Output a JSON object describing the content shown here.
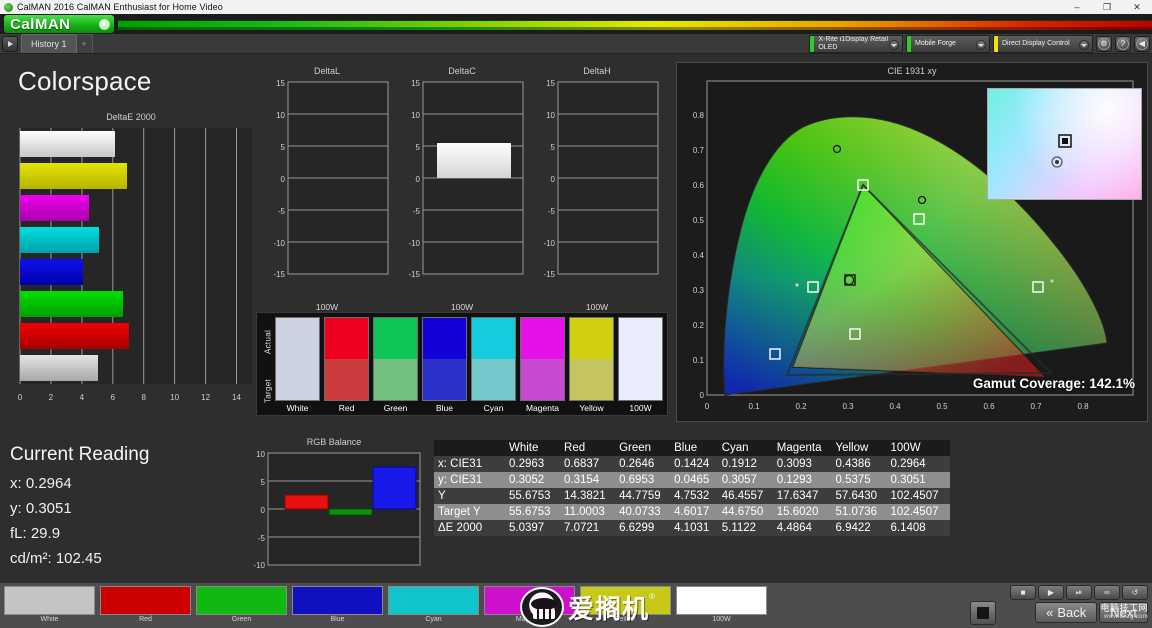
{
  "window": {
    "title": "CalMAN 2016 CalMAN Enthusiast for Home Video",
    "app_icon": "calman-app-icon",
    "minimize": "–",
    "maximize": "❐",
    "close": "✕"
  },
  "brand": {
    "name": "CalMAN",
    "dot_icon": "brand-dot-icon"
  },
  "toolbar": {
    "play_icon": "play-icon",
    "history_tab": "History 1",
    "history_add": "+",
    "meter": {
      "label": "X-Rite i1Display Retail\nOLED",
      "status_color": "#2ecc2e"
    },
    "source": {
      "label": "Mobile Forge",
      "status_color": "#2ecc2e"
    },
    "control": {
      "label": "Direct Display Control",
      "status_color": "#e8e800"
    },
    "buttons": [
      {
        "name": "settings-button",
        "glyph": "⚙"
      },
      {
        "name": "help-button",
        "glyph": "?"
      },
      {
        "name": "info-button",
        "glyph": "◀"
      }
    ]
  },
  "page_title": "Colorspace",
  "chart_data": [
    {
      "type": "bar",
      "orientation": "horizontal",
      "title": "DeltaE 2000",
      "categories": [
        "100W",
        "Yellow",
        "Magenta",
        "Cyan",
        "Blue",
        "Green",
        "Red",
        "White"
      ],
      "values": [
        6.1408,
        6.9422,
        4.4864,
        5.1122,
        4.1031,
        6.6299,
        7.0721,
        5.0397
      ],
      "colors": [
        "#ffffff",
        "#d4d400",
        "#d400d4",
        "#00c8c8",
        "#0000d8",
        "#00c000",
        "#d00000",
        "#c8c8c8"
      ],
      "xlabel": "",
      "ylabel": "",
      "xlim": [
        0,
        15
      ],
      "xticks": [
        0,
        2,
        4,
        6,
        8,
        10,
        12,
        14
      ],
      "grid": true
    },
    {
      "type": "bar",
      "title": "DeltaL",
      "categories": [
        "100W"
      ],
      "values": [
        0
      ],
      "ylim": [
        -15,
        15
      ],
      "yticks": [
        15,
        10,
        5,
        0,
        -5,
        -10,
        -15
      ],
      "xlabel": "100W",
      "grid": true
    },
    {
      "type": "bar",
      "title": "DeltaC",
      "categories": [
        "100W"
      ],
      "values": [
        5.5
      ],
      "ylim": [
        -15,
        15
      ],
      "yticks": [
        15,
        10,
        5,
        0,
        -5,
        -10,
        -15
      ],
      "xlabel": "100W",
      "grid": true
    },
    {
      "type": "bar",
      "title": "DeltaH",
      "categories": [
        "100W"
      ],
      "values": [
        0
      ],
      "ylim": [
        -15,
        15
      ],
      "yticks": [
        15,
        10,
        5,
        0,
        -5,
        -10,
        -15
      ],
      "xlabel": "100W",
      "grid": true
    },
    {
      "type": "bar",
      "title": "RGB Balance",
      "categories": [
        "Red",
        "Green",
        "Blue"
      ],
      "values": [
        2.5,
        -1.0,
        7.5
      ],
      "colors": [
        "#e81010",
        "#109010",
        "#1818e8"
      ],
      "ylim": [
        -10,
        10
      ],
      "yticks": [
        10,
        5,
        0,
        -5,
        -10
      ],
      "xlabel": "100W",
      "grid": true
    },
    {
      "type": "scatter",
      "title": "CIE 1931 xy",
      "xlabel": "x",
      "ylabel": "y",
      "xlim": [
        0,
        0.85
      ],
      "ylim": [
        0,
        0.9
      ],
      "xticks": [
        0,
        0.1,
        0.2,
        0.3,
        0.4,
        0.5,
        0.6,
        0.7,
        0.8
      ],
      "yticks": [
        0,
        0.1,
        0.2,
        0.3,
        0.4,
        0.5,
        0.6,
        0.7,
        0.8
      ],
      "annotation": "Gamut Coverage:  142.1%",
      "series": [
        {
          "name": "White measured",
          "x": 0.2963,
          "y": 0.3052,
          "marker": "circle"
        },
        {
          "name": "Red measured",
          "x": 0.6837,
          "y": 0.3154,
          "marker": "square"
        },
        {
          "name": "Green measured",
          "x": 0.2646,
          "y": 0.6953,
          "marker": "circle"
        },
        {
          "name": "Blue measured",
          "x": 0.1424,
          "y": 0.0465,
          "marker": "square"
        },
        {
          "name": "Cyan measured",
          "x": 0.1912,
          "y": 0.3057,
          "marker": "square"
        },
        {
          "name": "Magenta measured",
          "x": 0.3093,
          "y": 0.1293,
          "marker": "square"
        },
        {
          "name": "Yellow measured",
          "x": 0.4386,
          "y": 0.5375,
          "marker": "circle"
        },
        {
          "name": "100W measured",
          "x": 0.2964,
          "y": 0.3051,
          "marker": "square"
        }
      ]
    }
  ],
  "deltaE_chart": {
    "title": "DeltaE 2000",
    "xticks": [
      "0",
      "2",
      "4",
      "6",
      "8",
      "10",
      "12",
      "14"
    ]
  },
  "small_charts": [
    {
      "title": "DeltaL",
      "xlabel": "100W",
      "value": 0,
      "yticks": [
        "15",
        "10",
        "5",
        "0",
        "-5",
        "-10",
        "-15"
      ]
    },
    {
      "title": "DeltaC",
      "xlabel": "100W",
      "value": 5.5,
      "yticks": [
        "15",
        "10",
        "5",
        "0",
        "-5",
        "-10",
        "-15"
      ]
    },
    {
      "title": "DeltaH",
      "xlabel": "100W",
      "value": 0,
      "yticks": [
        "15",
        "10",
        "5",
        "0",
        "-5",
        "-10",
        "-15"
      ]
    }
  ],
  "swatches": {
    "row_labels": [
      "Actual",
      "Target"
    ],
    "items": [
      {
        "name": "White",
        "actual": "#ccd2e0",
        "target": "#ccd2e0"
      },
      {
        "name": "Red",
        "actual": "#ee0020",
        "target": "#cc3c3c"
      },
      {
        "name": "Green",
        "actual": "#0ec455",
        "target": "#74c080"
      },
      {
        "name": "Blue",
        "actual": "#1400d8",
        "target": "#2a30c8"
      },
      {
        "name": "Cyan",
        "actual": "#14ccdd",
        "target": "#74c8cc"
      },
      {
        "name": "Magenta",
        "actual": "#e810e8",
        "target": "#c84ad0"
      },
      {
        "name": "Yellow",
        "actual": "#d0d010",
        "target": "#c4c460"
      },
      {
        "name": "100W",
        "actual": "#e8ecfb",
        "target": "#e8ecfb"
      }
    ]
  },
  "cie": {
    "title": "CIE 1931 xy",
    "gamut_label": "Gamut Coverage:",
    "gamut_value": "142.1%",
    "xticks": [
      "0",
      "0.1",
      "0.2",
      "0.3",
      "0.4",
      "0.5",
      "0.6",
      "0.7",
      "0.8"
    ],
    "yticks": [
      "0",
      "0.1",
      "0.2",
      "0.3",
      "0.4",
      "0.5",
      "0.6",
      "0.7",
      "0.8"
    ]
  },
  "current_reading": {
    "heading": "Current Reading",
    "x": "x: 0.2964",
    "y": "y: 0.3051",
    "fL": "fL: 29.9",
    "cdm2": "cd/m²: 102.45"
  },
  "rgb_balance": {
    "title": "RGB Balance",
    "xlabel": "100W"
  },
  "table": {
    "columns": [
      "",
      "White",
      "Red",
      "Green",
      "Blue",
      "Cyan",
      "Magenta",
      "Yellow",
      "100W"
    ],
    "rows": [
      {
        "label": "x: CIE31",
        "values": [
          "0.2963",
          "0.6837",
          "0.2646",
          "0.1424",
          "0.1912",
          "0.3093",
          "0.4386",
          "0.2964"
        ]
      },
      {
        "label": "y: CIE31",
        "values": [
          "0.3052",
          "0.3154",
          "0.6953",
          "0.0465",
          "0.3057",
          "0.1293",
          "0.5375",
          "0.3051"
        ]
      },
      {
        "label": "Y",
        "values": [
          "55.6753",
          "14.3821",
          "44.7759",
          "4.7532",
          "46.4557",
          "17.6347",
          "57.6430",
          "102.4507"
        ]
      },
      {
        "label": "Target Y",
        "values": [
          "55.6753",
          "11.0003",
          "40.0733",
          "4.6017",
          "44.6750",
          "15.6020",
          "51.0736",
          "102.4507"
        ]
      },
      {
        "label": "ΔE 2000",
        "values": [
          "5.0397",
          "7.0721",
          "6.6299",
          "4.1031",
          "5.1122",
          "4.4864",
          "6.9422",
          "6.1408"
        ]
      }
    ]
  },
  "bottom_bar": {
    "swatches": [
      {
        "name": "White",
        "color": "#c4c4c4"
      },
      {
        "name": "Red",
        "color": "#cc0000"
      },
      {
        "name": "Green",
        "color": "#12b812"
      },
      {
        "name": "Blue",
        "color": "#1010c0"
      },
      {
        "name": "Cyan",
        "color": "#10c4cc"
      },
      {
        "name": "Magenta",
        "color": "#cc10cc"
      },
      {
        "name": "Yellow",
        "color": "#c8c818"
      },
      {
        "name": "100W",
        "color": "#ffffff"
      }
    ],
    "transport": [
      {
        "name": "stop-button",
        "glyph": "■"
      },
      {
        "name": "play-button",
        "glyph": "▶"
      },
      {
        "name": "pause-step-button",
        "glyph": "⏯"
      },
      {
        "name": "loop-button",
        "glyph": "∞"
      },
      {
        "name": "refresh-button",
        "glyph": "↺"
      }
    ],
    "back": "Back",
    "next": "Next",
    "back_icon": "«",
    "next_icon": "»",
    "stop_big": "stop-square-icon"
  },
  "watermark": {
    "brand_cn": "爱搁机",
    "tm": "®",
    "site_cn": "电脑技工网",
    "site_url": "www.dnzg.com"
  }
}
